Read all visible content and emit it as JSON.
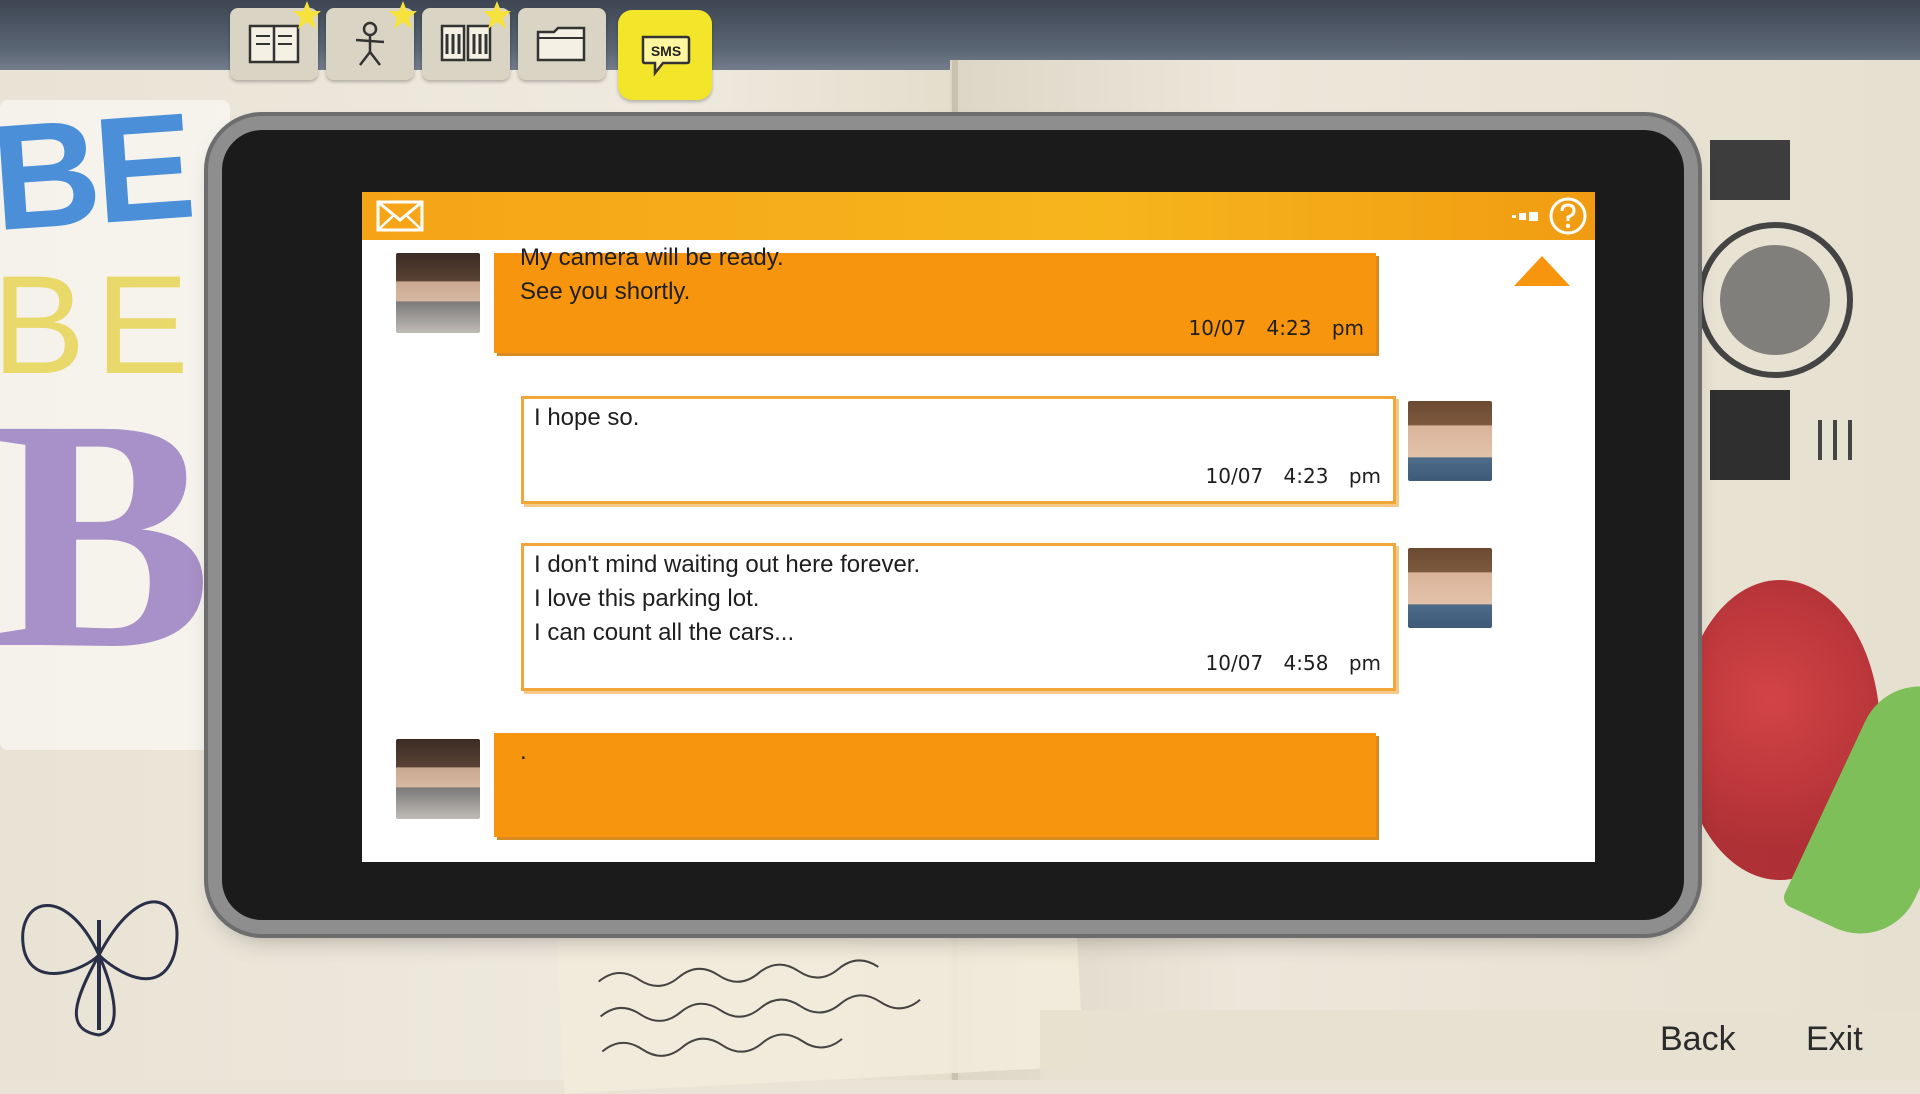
{
  "journal_tabs": {
    "tabs": [
      {
        "name": "journal",
        "icon": "journal-icon"
      },
      {
        "name": "characters",
        "icon": "stick-figure-icon"
      },
      {
        "name": "photos",
        "icon": "photos-icon"
      },
      {
        "name": "files",
        "icon": "folder-icon"
      },
      {
        "name": "sms",
        "icon": "sms-bubble-icon",
        "label": "SMS",
        "active": true
      }
    ]
  },
  "phone": {
    "status_icons": [
      "mail-icon",
      "signal-icon",
      "help-icon"
    ],
    "accent_color": "#f7950e",
    "messages": [
      {
        "sender": "other",
        "avatar": "max-avatar",
        "text": "My camera will be ready.\nSee you shortly.",
        "date": "10/07",
        "time": "4:23 pm"
      },
      {
        "sender": "self",
        "avatar": "warren-avatar",
        "text": "I hope so.",
        "date": "10/07",
        "time": "4:23 pm"
      },
      {
        "sender": "self",
        "avatar": "warren-avatar",
        "text": "I don't mind waiting out here forever.\nI love this parking lot.\nI can count all the cars...",
        "date": "10/07",
        "time": "4:58 pm"
      },
      {
        "sender": "other",
        "avatar": "max-avatar",
        "text": ".",
        "date": "",
        "time": ""
      }
    ]
  },
  "nav": {
    "back": "Back",
    "exit": "Exit"
  }
}
